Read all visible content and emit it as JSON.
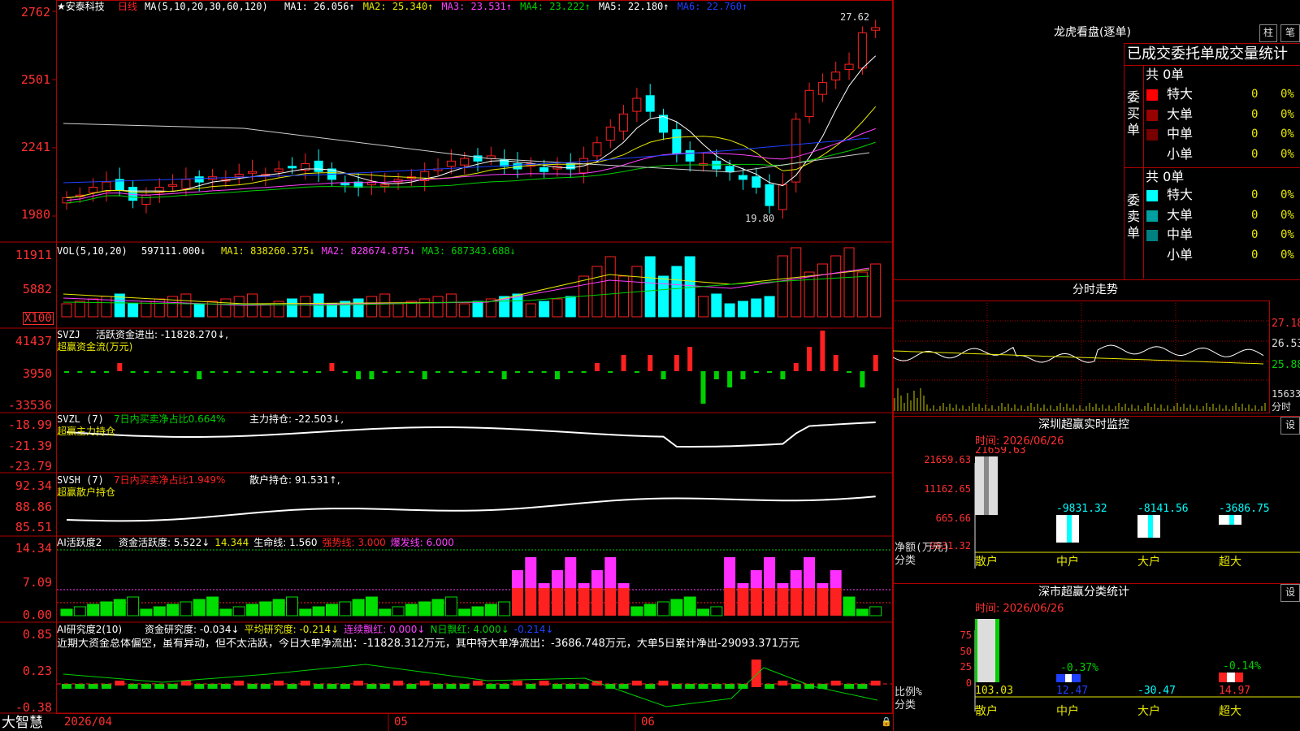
{
  "colors": {
    "up": "#ff2020",
    "down": "#00ffff",
    "green": "#00d000",
    "yellow": "#e8e800",
    "magenta": "#ff40ff",
    "white": "#ffffff",
    "grid": "#b00000",
    "axisText": "#ff3030"
  },
  "main": {
    "title": "★安泰科技",
    "period": "日线",
    "ma_label": "MA(5,10,20,30,60,120)",
    "ma": [
      {
        "label": "MA1: 26.056↑",
        "color": "#ffffff"
      },
      {
        "label": "MA2: 25.340↑",
        "color": "#e8e800"
      },
      {
        "label": "MA3: 23.531↑",
        "color": "#ff40ff"
      },
      {
        "label": "MA4: 23.222↑",
        "color": "#00d000"
      },
      {
        "label": "MA5: 22.180↑",
        "color": "#ffffff"
      },
      {
        "label": "MA6: 22.760↑",
        "color": "#2040ff"
      }
    ],
    "yticks": [
      "2762",
      "2501",
      "2241",
      "1980"
    ],
    "high_label": "27.62",
    "low_label": "19.80"
  },
  "vol": {
    "title": "VOL(5,10,20)",
    "value": "597111.000↓",
    "ma": [
      {
        "label": "MA1: 838260.375↓",
        "color": "#e8e800"
      },
      {
        "label": "MA2: 828674.875↓",
        "color": "#ff40ff"
      },
      {
        "label": "MA3: 687343.688↓",
        "color": "#00d000"
      }
    ],
    "yticks": [
      "11911",
      "5882",
      "X100"
    ]
  },
  "svzj": {
    "title": "SVZJ",
    "line": "活跃资金进出: -11828.270↓,",
    "sub": "超赢资金流(万元)",
    "yticks": [
      "41437",
      "3950",
      "-33536"
    ]
  },
  "svzl": {
    "title": "SVZL (7)",
    "line1": "7日内买卖净占比0.664%",
    "line2": "主力持仓: -22.503↓,",
    "sub": "超赢主力持仓",
    "yticks": [
      "-18.99",
      "-21.39",
      "-23.79"
    ]
  },
  "svsh": {
    "title": "SVSH (7)",
    "line1": "7日内买卖净占比1.949%",
    "line2": "散户持仓: 91.531↑,",
    "sub": "超赢散户持仓",
    "yticks": [
      "92.34",
      "88.86",
      "85.51"
    ]
  },
  "ai1": {
    "title": "AI活跃度2",
    "items": [
      {
        "label": "资金活跃度: 5.522↓",
        "color": "#ffffff"
      },
      {
        "label": "14.344",
        "color": "#e8e800"
      },
      {
        "label": "生命线: 1.560",
        "color": "#ffffff"
      },
      {
        "label": "强势线: 3.000",
        "color": "#ff2020"
      },
      {
        "label": "爆发线: 6.000",
        "color": "#ff40ff"
      }
    ],
    "yticks": [
      "14.34",
      "7.09",
      "0.00"
    ]
  },
  "ai2": {
    "title": "AI研究度2(10)",
    "items": [
      {
        "label": "资金研究度: -0.034↓",
        "color": "#ffffff"
      },
      {
        "label": "平均研究度: -0.214↓",
        "color": "#e8e800"
      },
      {
        "label": "连续飘红: 0.000↓",
        "color": "#ff40ff"
      },
      {
        "label": "N日飘红: 4.000↓",
        "color": "#00d000"
      },
      {
        "label": "-0.214↓",
        "color": "#2040ff"
      }
    ],
    "yticks": [
      "0.85",
      "0.23",
      "-0.38"
    ],
    "comment": "近期大资金总体偏空，虽有异动，但不太活跃，今日大单净流出：-11828.312万元，其中特大单净流出：-3686.748万元，大单5日累计净出-29093.371万元"
  },
  "xaxis": {
    "labels": [
      "2026/04",
      "05",
      "06"
    ]
  },
  "footer": {
    "brand": "大智慧"
  },
  "right": {
    "lhb_title": "龙虎看盘(逐单)",
    "btn_zhu": "柱",
    "btn_bi": "笔",
    "table_title": "已成交委托单成交量统计",
    "buy": {
      "side": "委买单",
      "total": "共 0单",
      "rows": [
        {
          "name": "特大",
          "val": "0",
          "pct": "0%",
          "color": "#ff0000"
        },
        {
          "name": "大单",
          "val": "0",
          "pct": "0%",
          "color": "#990000"
        },
        {
          "name": "中单",
          "val": "0",
          "pct": "0%",
          "color": "#770000"
        },
        {
          "name": "小单",
          "val": "0",
          "pct": "0%",
          "color": "#000000"
        }
      ]
    },
    "sell": {
      "side": "委卖单",
      "total": "共 0单",
      "rows": [
        {
          "name": "特大",
          "val": "0",
          "pct": "0%",
          "color": "#00ffff"
        },
        {
          "name": "大单",
          "val": "0",
          "pct": "0%",
          "color": "#00a0a0"
        },
        {
          "name": "中单",
          "val": "0",
          "pct": "0%",
          "color": "#008080"
        },
        {
          "name": "小单",
          "val": "0",
          "pct": "0%",
          "color": "#000000"
        }
      ]
    },
    "fs_title": "分时走势",
    "fs_ticks": [
      "27.18",
      "26.53",
      "25.88",
      "15633",
      "分时"
    ],
    "mon_title": "深圳超赢实时监控",
    "mon_btn": "设",
    "mon_time": "时间: 2026/06/26",
    "mon_values": [
      "21659.63",
      "-9831.32",
      "-8141.56",
      "-3686.75"
    ],
    "mon_yticks": [
      "21659.63",
      "11162.65",
      "665.66",
      "-9831.32"
    ],
    "mon_ylabel": "净额(万元)",
    "mon_xlabel": "分类",
    "cats": [
      "散户",
      "中户",
      "大户",
      "超大"
    ],
    "stat_title": "深市超赢分类统计",
    "stat_btn": "设",
    "stat_time": "时间: 2026/06/26",
    "stat_yticks": [
      "75",
      "50",
      "25",
      "0"
    ],
    "stat_pct": [
      "-0.37%",
      "-0.14%"
    ],
    "stat_values": [
      "103.03",
      "12.47",
      "-30.47",
      "14.97"
    ],
    "stat_ylabel": "比例%",
    "stat_xlabel": "分类"
  }
}
